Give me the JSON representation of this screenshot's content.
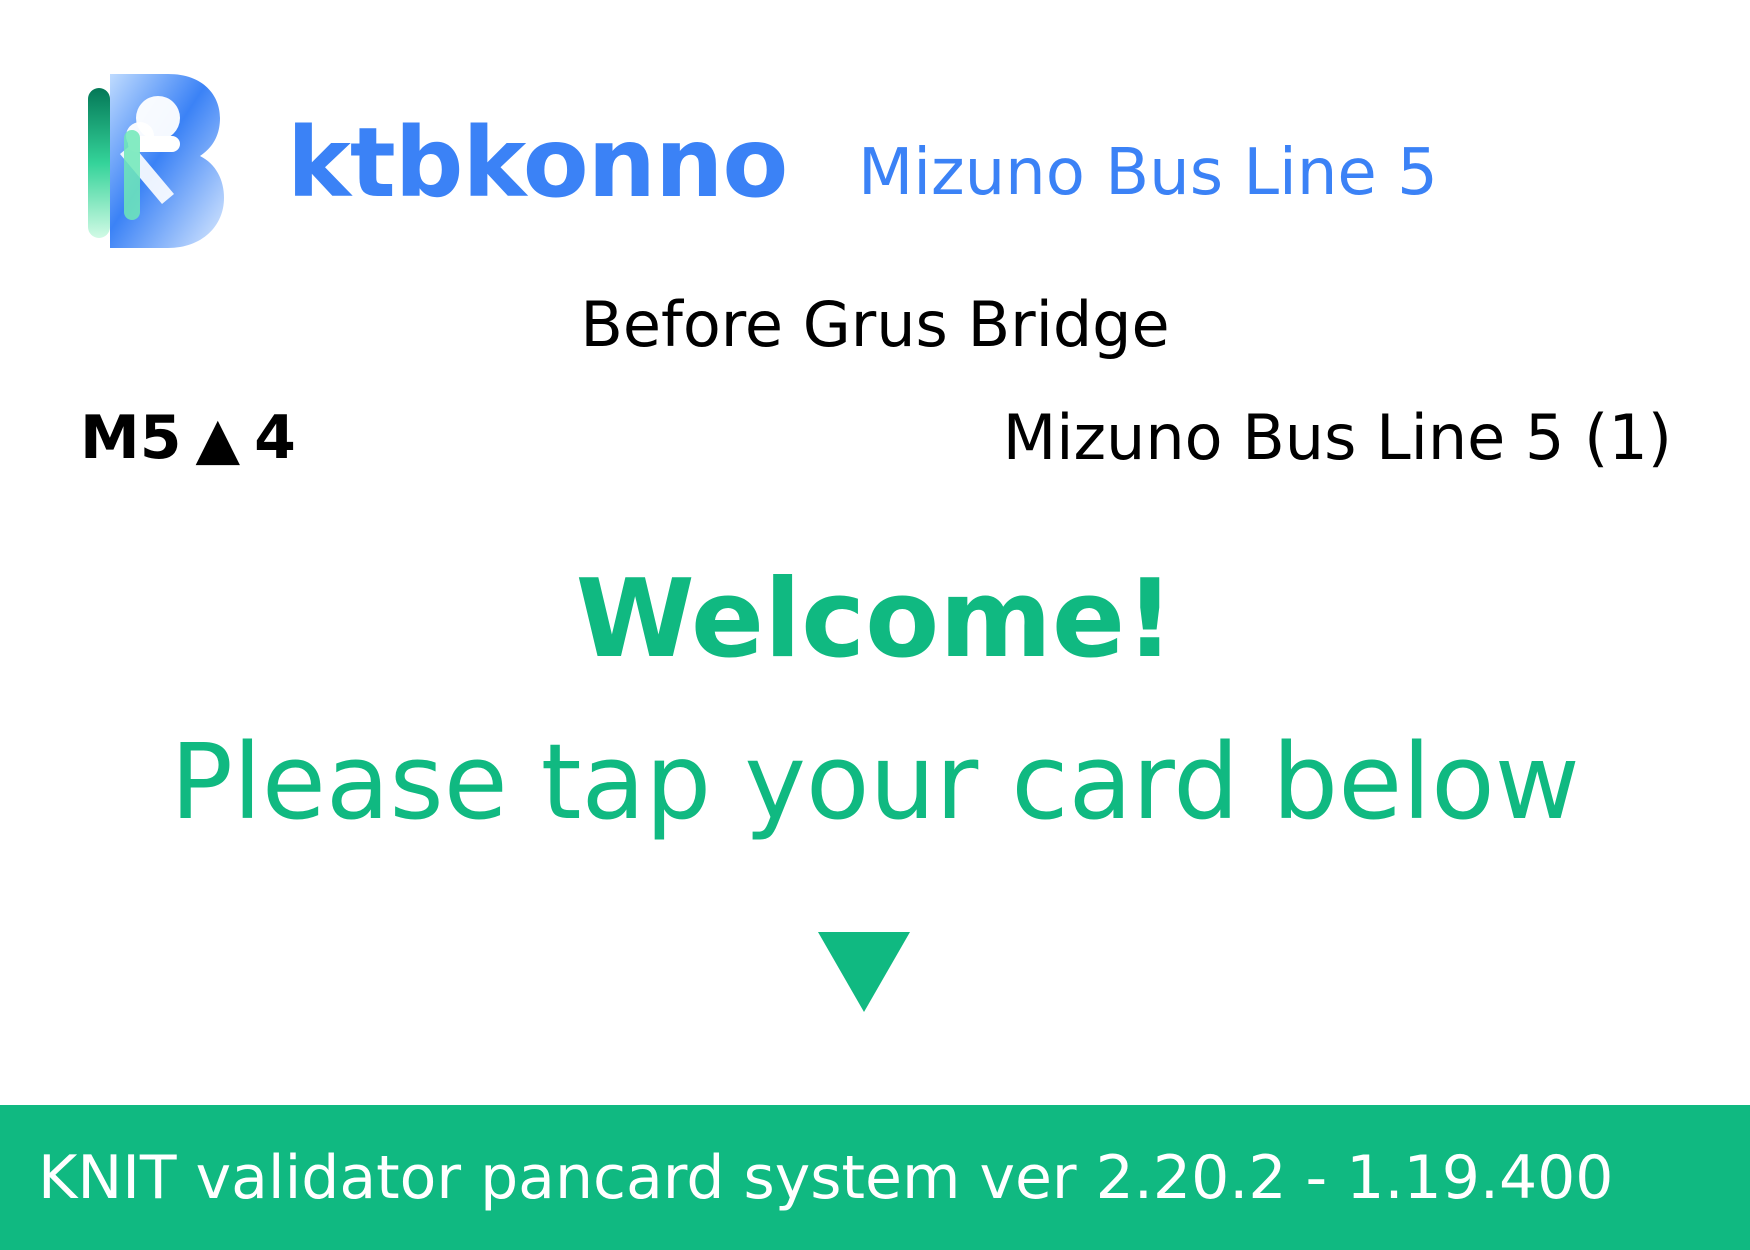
{
  "colors": {
    "brand_blue": "#3b82f6",
    "accent_green": "#10b981",
    "footer_green": "#10b981",
    "text_black": "#000000",
    "background": "#ffffff"
  },
  "header": {
    "logo_icon": "ktbkonno-b-logo-icon",
    "brand_name": "ktbkonno",
    "line_title": "Mizuno Bus Line 5"
  },
  "stop": {
    "name": "Before Grus Bridge",
    "code_prefix": "M5",
    "direction_icon": "up-triangle-icon",
    "direction_glyph": "▲",
    "code_number": "4",
    "route_name": "Mizuno Bus Line 5 (1)"
  },
  "prompt": {
    "welcome": "Welcome!",
    "instruction": "Please tap your card below",
    "arrow_icon": "down-triangle-icon"
  },
  "footer": {
    "system_text": "KNIT validator pancard system ver 2.20.2 - 1.19.400"
  }
}
